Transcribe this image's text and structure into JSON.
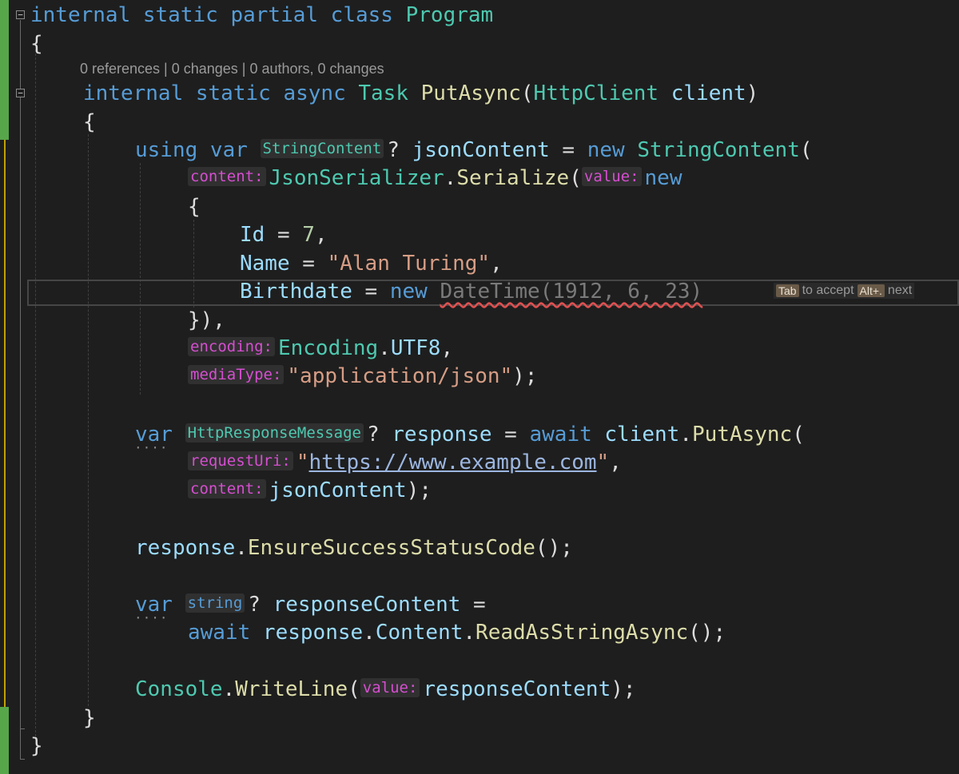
{
  "codelens": "0 references | 0 changes | 0 authors, 0 changes",
  "inline_suggestion": {
    "tab_key": "Tab",
    "tab_text": "to accept",
    "alt_key": "Alt+.",
    "alt_text": "next"
  },
  "collapse_glyph": "−",
  "colors": {
    "keyword": "#569cd6",
    "type": "#4ec9b0",
    "method": "#dcdcaa",
    "variable": "#9cdcfe",
    "string": "#d69d85",
    "number": "#b5cea8",
    "param_hint": "#d54ed0"
  },
  "lines": [
    [
      [
        "kw",
        "internal static partial class "
      ],
      [
        "ty",
        "Program"
      ]
    ],
    [
      [
        "pu",
        "{"
      ]
    ],
    [
      [
        "kw",
        "internal static async "
      ],
      [
        "ty",
        "Task "
      ],
      [
        "mt",
        "PutAsync"
      ],
      [
        "pu",
        "("
      ],
      [
        "ty",
        "HttpClient "
      ],
      [
        "pv",
        "client"
      ],
      [
        "pu",
        ")"
      ]
    ],
    [
      [
        "pu",
        "{"
      ]
    ],
    [
      [
        "kw",
        "using var "
      ],
      [
        "hint-type",
        "StringContent"
      ],
      [
        "pu",
        "? "
      ],
      [
        "pv",
        "jsonContent"
      ],
      [
        "pu",
        " = "
      ],
      [
        "kw",
        "new "
      ],
      [
        "ty",
        "StringContent"
      ],
      [
        "pu",
        "("
      ]
    ],
    [
      [
        "hint-param",
        "content:"
      ],
      [
        "ty",
        "JsonSerializer"
      ],
      [
        "pu",
        "."
      ],
      [
        "mt",
        "Serialize"
      ],
      [
        "pu",
        "("
      ],
      [
        "hint-param",
        "value:"
      ],
      [
        "kw",
        "new"
      ]
    ],
    [
      [
        "pu",
        "{"
      ]
    ],
    [
      [
        "pv",
        "Id"
      ],
      [
        "pu",
        " = "
      ],
      [
        "nu",
        "7"
      ],
      [
        "pu",
        ","
      ]
    ],
    [
      [
        "pv",
        "Name"
      ],
      [
        "pu",
        " = "
      ],
      [
        "st",
        "\"Alan Turing\""
      ],
      [
        "pu",
        ","
      ]
    ],
    [
      [
        "pv",
        "Birthdate"
      ],
      [
        "pu",
        " = "
      ],
      [
        "kw",
        "new "
      ],
      [
        "ghost-sq",
        "DateTime(1912, 6, 23)"
      ]
    ],
    [
      [
        "pu",
        "}),"
      ]
    ],
    [
      [
        "hint-param",
        "encoding:"
      ],
      [
        "ty",
        "Encoding"
      ],
      [
        "pu",
        "."
      ],
      [
        "pv",
        "UTF8"
      ],
      [
        "pu",
        ","
      ]
    ],
    [
      [
        "hint-param",
        "mediaType:"
      ],
      [
        "st",
        "\"application/json\""
      ],
      [
        "pu",
        ");"
      ]
    ],
    [],
    [
      [
        "kw",
        "var "
      ],
      [
        "hint-type",
        "HttpResponseMessage"
      ],
      [
        "pu",
        "? "
      ],
      [
        "pv",
        "response"
      ],
      [
        "pu",
        " = "
      ],
      [
        "kw",
        "await "
      ],
      [
        "pv",
        "client"
      ],
      [
        "pu",
        "."
      ],
      [
        "mt",
        "PutAsync"
      ],
      [
        "pu",
        "("
      ]
    ],
    [
      [
        "hint-param",
        "requestUri:"
      ],
      [
        "st",
        "\""
      ],
      [
        "url",
        "https://www.example.com"
      ],
      [
        "st",
        "\""
      ],
      [
        "pu",
        ","
      ]
    ],
    [
      [
        "hint-param",
        "content:"
      ],
      [
        "pv",
        "jsonContent"
      ],
      [
        "pu",
        ");"
      ]
    ],
    [],
    [
      [
        "pv",
        "response"
      ],
      [
        "pu",
        "."
      ],
      [
        "mt",
        "EnsureSuccessStatusCode"
      ],
      [
        "pu",
        "();"
      ]
    ],
    [],
    [
      [
        "kw",
        "var "
      ],
      [
        "hint-kw",
        "string"
      ],
      [
        "pu",
        "? "
      ],
      [
        "pv",
        "responseContent"
      ],
      [
        "pu",
        " ="
      ]
    ],
    [
      [
        "kw",
        "await "
      ],
      [
        "pv",
        "response"
      ],
      [
        "pu",
        "."
      ],
      [
        "pv",
        "Content"
      ],
      [
        "pu",
        "."
      ],
      [
        "mt",
        "ReadAsStringAsync"
      ],
      [
        "pu",
        "();"
      ]
    ],
    [],
    [
      [
        "ty",
        "Console"
      ],
      [
        "pu",
        "."
      ],
      [
        "mt",
        "WriteLine"
      ],
      [
        "pu",
        "("
      ],
      [
        "hint-param",
        "value:"
      ],
      [
        "pv",
        "responseContent"
      ],
      [
        "pu",
        ");"
      ]
    ],
    [
      [
        "pu",
        "}"
      ]
    ],
    [
      [
        "pu",
        "}"
      ]
    ]
  ]
}
